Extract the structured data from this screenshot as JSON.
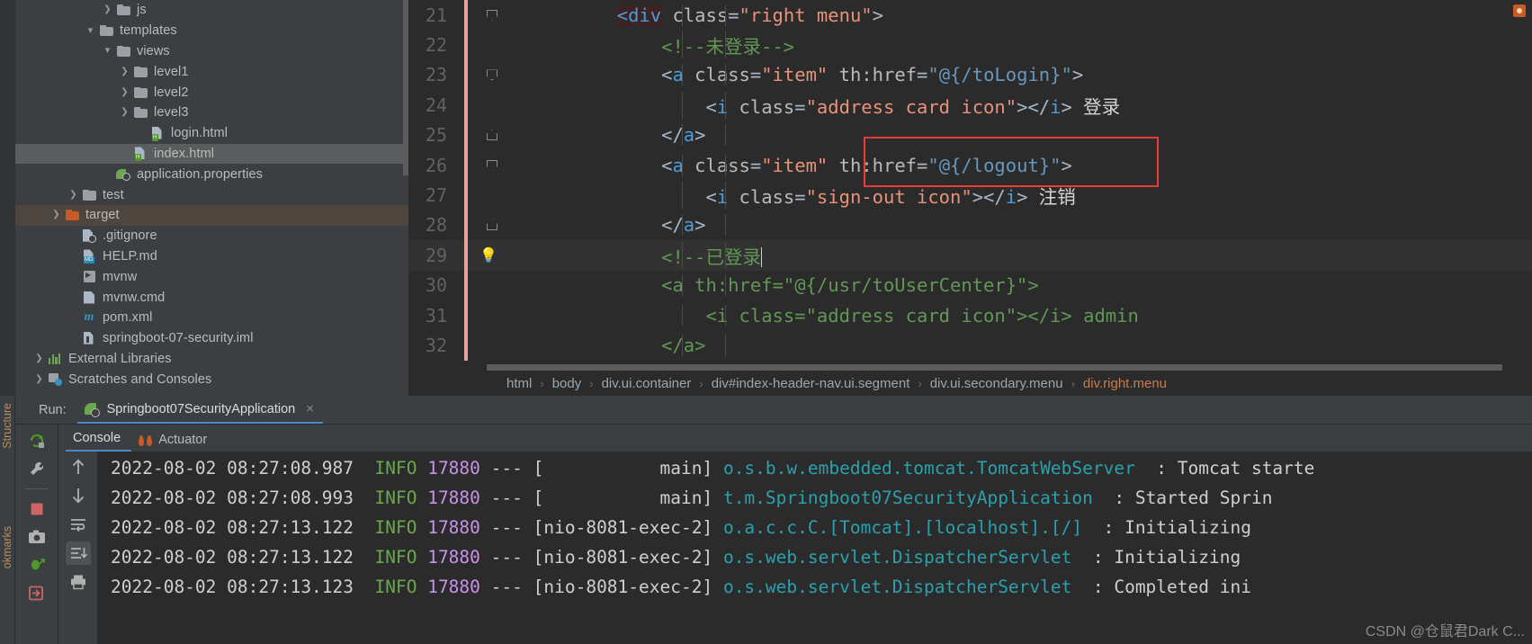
{
  "project_tree": [
    {
      "label": "js",
      "indent": 5,
      "arrow": "right",
      "icon": "folder",
      "state": "none"
    },
    {
      "label": "templates",
      "indent": 4,
      "arrow": "down",
      "icon": "folder",
      "state": "none"
    },
    {
      "label": "views",
      "indent": 5,
      "arrow": "down",
      "icon": "folder",
      "state": "none"
    },
    {
      "label": "level1",
      "indent": 6,
      "arrow": "right",
      "icon": "folder",
      "state": "none"
    },
    {
      "label": "level2",
      "indent": 6,
      "arrow": "right",
      "icon": "folder",
      "state": "none"
    },
    {
      "label": "level3",
      "indent": 6,
      "arrow": "right",
      "icon": "folder",
      "state": "none"
    },
    {
      "label": "login.html",
      "indent": 7,
      "arrow": "none",
      "icon": "html-file",
      "state": "none"
    },
    {
      "label": "index.html",
      "indent": 6,
      "arrow": "none",
      "icon": "html-file",
      "state": "selected-gray"
    },
    {
      "label": "application.properties",
      "indent": 5,
      "arrow": "none",
      "icon": "properties-file",
      "state": "none"
    },
    {
      "label": "test",
      "indent": 3,
      "arrow": "right",
      "icon": "folder",
      "state": "none"
    },
    {
      "label": "target",
      "indent": 2,
      "arrow": "right",
      "icon": "folder-orange",
      "state": "selected-brown"
    },
    {
      "label": ".gitignore",
      "indent": 3,
      "arrow": "none",
      "icon": "gitignore-file",
      "state": "none"
    },
    {
      "label": "HELP.md",
      "indent": 3,
      "arrow": "none",
      "icon": "markdown-file",
      "state": "none"
    },
    {
      "label": "mvnw",
      "indent": 3,
      "arrow": "none",
      "icon": "executable-file",
      "state": "none"
    },
    {
      "label": "mvnw.cmd",
      "indent": 3,
      "arrow": "none",
      "icon": "cmd-file",
      "state": "none"
    },
    {
      "label": "pom.xml",
      "indent": 3,
      "arrow": "none",
      "icon": "maven-file",
      "state": "none"
    },
    {
      "label": "springboot-07-security.iml",
      "indent": 3,
      "arrow": "none",
      "icon": "iml-file",
      "state": "none"
    },
    {
      "label": "External Libraries",
      "indent": 1,
      "arrow": "right",
      "icon": "library-icon",
      "state": "none"
    },
    {
      "label": "Scratches and Consoles",
      "indent": 1,
      "arrow": "right",
      "icon": "scratch-icon",
      "state": "none"
    }
  ],
  "editor": {
    "lines": [
      {
        "num": "21",
        "fold": "down",
        "changebar": true,
        "bulb": false,
        "highlight": false,
        "tokens": [
          {
            "t": "        ",
            "c": "plain"
          },
          {
            "t": "<div",
            "c": "match-brace"
          },
          {
            "t": " ",
            "c": "plain"
          },
          {
            "t": "class",
            "c": "attr"
          },
          {
            "t": "=",
            "c": "plain"
          },
          {
            "t": "\"right menu\"",
            "c": "orange"
          },
          {
            "t": ">",
            "c": "plain"
          }
        ]
      },
      {
        "num": "22",
        "fold": "none",
        "changebar": true,
        "bulb": false,
        "highlight": false,
        "tokens": [
          {
            "t": "            ",
            "c": "plain"
          },
          {
            "t": "<!--未登录-->",
            "c": "comment"
          }
        ]
      },
      {
        "num": "23",
        "fold": "down",
        "changebar": true,
        "bulb": false,
        "highlight": false,
        "tokens": [
          {
            "t": "            ",
            "c": "plain"
          },
          {
            "t": "<",
            "c": "plain"
          },
          {
            "t": "a",
            "c": "cyan"
          },
          {
            "t": " ",
            "c": "plain"
          },
          {
            "t": "class",
            "c": "attr"
          },
          {
            "t": "=",
            "c": "plain"
          },
          {
            "t": "\"item\"",
            "c": "orange"
          },
          {
            "t": " ",
            "c": "plain"
          },
          {
            "t": "th:href",
            "c": "attr"
          },
          {
            "t": "=",
            "c": "plain"
          },
          {
            "t": "\"@{/toLogin}\"",
            "c": "blue"
          },
          {
            "t": ">",
            "c": "plain"
          }
        ]
      },
      {
        "num": "24",
        "fold": "none",
        "changebar": true,
        "bulb": false,
        "highlight": false,
        "tokens": [
          {
            "t": "                ",
            "c": "plain"
          },
          {
            "t": "<",
            "c": "plain"
          },
          {
            "t": "i",
            "c": "cyan"
          },
          {
            "t": " ",
            "c": "plain"
          },
          {
            "t": "class",
            "c": "attr"
          },
          {
            "t": "=",
            "c": "plain"
          },
          {
            "t": "\"address card icon\"",
            "c": "orange"
          },
          {
            "t": "></",
            "c": "plain"
          },
          {
            "t": "i",
            "c": "cyan"
          },
          {
            "t": "> ",
            "c": "plain"
          },
          {
            "t": "登录",
            "c": "white"
          }
        ]
      },
      {
        "num": "25",
        "fold": "up",
        "changebar": true,
        "bulb": false,
        "highlight": false,
        "tokens": [
          {
            "t": "            ",
            "c": "plain"
          },
          {
            "t": "</",
            "c": "plain"
          },
          {
            "t": "a",
            "c": "cyan"
          },
          {
            "t": ">",
            "c": "plain"
          }
        ]
      },
      {
        "num": "26",
        "fold": "down",
        "changebar": true,
        "bulb": false,
        "highlight": false,
        "tokens": [
          {
            "t": "            ",
            "c": "plain"
          },
          {
            "t": "<",
            "c": "plain"
          },
          {
            "t": "a",
            "c": "cyan"
          },
          {
            "t": " ",
            "c": "plain"
          },
          {
            "t": "class",
            "c": "attr"
          },
          {
            "t": "=",
            "c": "plain"
          },
          {
            "t": "\"item\"",
            "c": "orange"
          },
          {
            "t": " ",
            "c": "plain"
          },
          {
            "t": "th:href",
            "c": "attr"
          },
          {
            "t": "=",
            "c": "plain"
          },
          {
            "t": "\"@{/logout}\"",
            "c": "blue"
          },
          {
            "t": ">",
            "c": "plain"
          }
        ]
      },
      {
        "num": "27",
        "fold": "none",
        "changebar": true,
        "bulb": false,
        "highlight": false,
        "tokens": [
          {
            "t": "                ",
            "c": "plain"
          },
          {
            "t": "<",
            "c": "plain"
          },
          {
            "t": "i",
            "c": "cyan"
          },
          {
            "t": " ",
            "c": "plain"
          },
          {
            "t": "class",
            "c": "attr"
          },
          {
            "t": "=",
            "c": "plain"
          },
          {
            "t": "\"sign-out icon\"",
            "c": "orange"
          },
          {
            "t": "></",
            "c": "plain"
          },
          {
            "t": "i",
            "c": "cyan"
          },
          {
            "t": "> ",
            "c": "plain"
          },
          {
            "t": "注销",
            "c": "white"
          }
        ]
      },
      {
        "num": "28",
        "fold": "up",
        "changebar": true,
        "bulb": false,
        "highlight": false,
        "tokens": [
          {
            "t": "            ",
            "c": "plain"
          },
          {
            "t": "</",
            "c": "plain"
          },
          {
            "t": "a",
            "c": "cyan"
          },
          {
            "t": ">",
            "c": "plain"
          }
        ]
      },
      {
        "num": "29",
        "fold": "none",
        "changebar": true,
        "bulb": true,
        "highlight": true,
        "tokens": [
          {
            "t": "            ",
            "c": "plain"
          },
          {
            "t": "<!--已登录",
            "c": "comment"
          },
          {
            "t": "CARET",
            "c": "caret"
          }
        ]
      },
      {
        "num": "30",
        "fold": "none",
        "changebar": true,
        "bulb": false,
        "highlight": false,
        "tokens": [
          {
            "t": "            ",
            "c": "plain"
          },
          {
            "t": "<a th:href=\"@{/usr/toUserCenter}\">",
            "c": "comment"
          }
        ]
      },
      {
        "num": "31",
        "fold": "none",
        "changebar": true,
        "bulb": false,
        "highlight": false,
        "tokens": [
          {
            "t": "                ",
            "c": "plain"
          },
          {
            "t": "<i class=\"address card icon\"></i> admin",
            "c": "comment"
          }
        ]
      },
      {
        "num": "32",
        "fold": "none",
        "changebar": true,
        "bulb": false,
        "highlight": false,
        "tokens": [
          {
            "t": "            ",
            "c": "plain"
          },
          {
            "t": "</a>",
            "c": "comment"
          }
        ]
      }
    ],
    "breadcrumb": [
      {
        "label": "html",
        "last": false
      },
      {
        "label": "body",
        "last": false
      },
      {
        "label": "div.ui.container",
        "last": false
      },
      {
        "label": "div#index-header-nav.ui.segment",
        "last": false
      },
      {
        "label": "div.ui.secondary.menu",
        "last": false
      },
      {
        "label": "div.right.menu",
        "last": true
      }
    ],
    "breadcrumb_separator": "›"
  },
  "run_panel": {
    "run_label": "Run:",
    "tab_title": "Springboot07SecurityApplication",
    "close_glyph": "×",
    "console_tabs": [
      {
        "label": "Console",
        "active": true
      },
      {
        "label": "Actuator",
        "active": false
      }
    ],
    "logs": [
      {
        "date": "2022-08-02 08:27:08.987",
        "level": "INFO",
        "pid": "17880",
        "dash": "---",
        "thread": "[           main]",
        "logger": "o.s.b.w.embedded.tomcat.TomcatWebServer",
        "msg": ": Tomcat starte"
      },
      {
        "date": "2022-08-02 08:27:08.993",
        "level": "INFO",
        "pid": "17880",
        "dash": "---",
        "thread": "[           main]",
        "logger": "t.m.Springboot07SecurityApplication",
        "msg": ": Started Sprin"
      },
      {
        "date": "2022-08-02 08:27:13.122",
        "level": "INFO",
        "pid": "17880",
        "dash": "---",
        "thread": "[nio-8081-exec-2]",
        "logger": "o.a.c.c.C.[Tomcat].[localhost].[/]",
        "msg": ": Initializing"
      },
      {
        "date": "2022-08-02 08:27:13.122",
        "level": "INFO",
        "pid": "17880",
        "dash": "---",
        "thread": "[nio-8081-exec-2]",
        "logger": "o.s.web.servlet.DispatcherServlet",
        "msg": ": Initializing"
      },
      {
        "date": "2022-08-02 08:27:13.123",
        "level": "INFO",
        "pid": "17880",
        "dash": "---",
        "thread": "[nio-8081-exec-2]",
        "logger": "o.s.web.servlet.DispatcherServlet",
        "msg": ": Completed ini"
      }
    ],
    "watermark": "CSDN @仓鼠君Dark C..."
  },
  "side_rails": {
    "structure": "Structure",
    "bookmarks": "okmarks"
  },
  "colors": {
    "accent_blue": "#4a88c7",
    "selection_blue": "#4b6eaf",
    "highlight_red": "#f03a3a",
    "comment_green": "#629755",
    "string_orange": "#e8927c"
  }
}
